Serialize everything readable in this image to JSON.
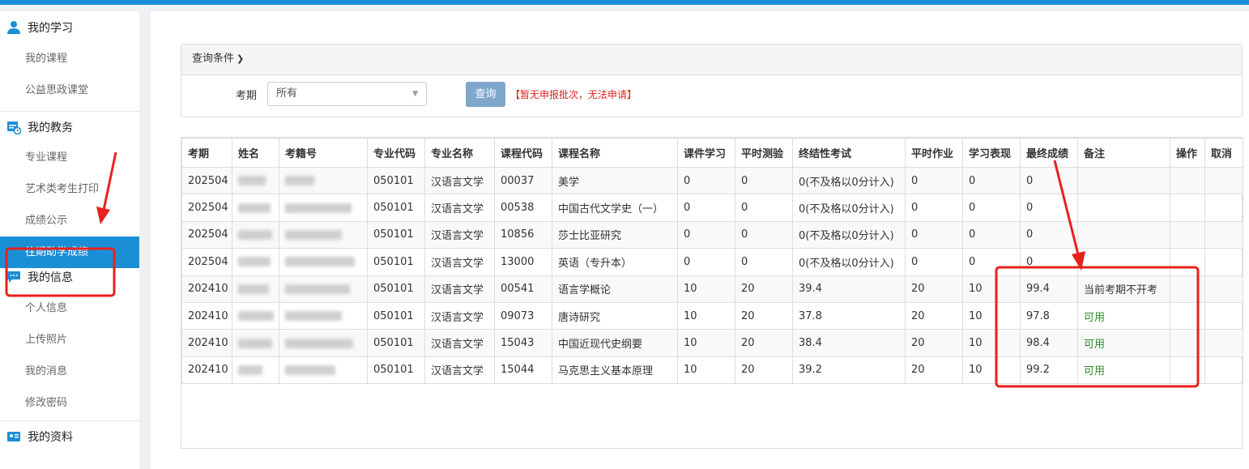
{
  "sidebar": {
    "groups": [
      {
        "title": "我的学习",
        "icon": "user-icon",
        "items": [
          "我的课程",
          "公益思政课堂"
        ]
      },
      {
        "title": "我的教务",
        "icon": "calendar-icon",
        "items": [
          "专业课程",
          "艺术类考生打印",
          "成绩公示",
          "往期助学成绩"
        ]
      },
      {
        "title": "我的信息",
        "icon": "chat-icon",
        "items": [
          "个人信息",
          "上传照片",
          "我的消息",
          "修改密码"
        ]
      },
      {
        "title": "我的资料",
        "icon": "id-card-icon",
        "items": []
      }
    ],
    "active_item": "往期助学成绩"
  },
  "query": {
    "header": "查询条件",
    "term_label": "考期",
    "term_value": "所有",
    "search_button": "查询",
    "notice": "【暂无申报批次，无法申请】"
  },
  "table": {
    "columns": [
      "考期",
      "姓名",
      "考籍号",
      "专业代码",
      "专业名称",
      "课程代码",
      "课程名称",
      "课件学习",
      "平时测验",
      "终结性考试",
      "平时作业",
      "学习表现",
      "最终成绩",
      "备注",
      "操作",
      "取消"
    ],
    "rows": [
      [
        "202504",
        "",
        "",
        "050101",
        "汉语言文学",
        "00037",
        "美学",
        "0",
        "0",
        "0(不及格以0分计入)",
        "0",
        "0",
        "0",
        "",
        "",
        ""
      ],
      [
        "202504",
        "",
        "",
        "050101",
        "汉语言文学",
        "00538",
        "中国古代文学史（一）",
        "0",
        "0",
        "0(不及格以0分计入)",
        "0",
        "0",
        "0",
        "",
        "",
        ""
      ],
      [
        "202504",
        "",
        "",
        "050101",
        "汉语言文学",
        "10856",
        "莎士比亚研究",
        "0",
        "0",
        "0(不及格以0分计入)",
        "0",
        "0",
        "0",
        "",
        "",
        ""
      ],
      [
        "202504",
        "",
        "",
        "050101",
        "汉语言文学",
        "13000",
        "英语（专升本）",
        "0",
        "0",
        "0(不及格以0分计入)",
        "0",
        "0",
        "0",
        "",
        "",
        ""
      ],
      [
        "202410",
        "",
        "",
        "050101",
        "汉语言文学",
        "00541",
        "语言学概论",
        "10",
        "20",
        "39.4",
        "20",
        "10",
        "99.4",
        "当前考期不开考",
        "",
        ""
      ],
      [
        "202410",
        "",
        "",
        "050101",
        "汉语言文学",
        "09073",
        "唐诗研究",
        "10",
        "20",
        "37.8",
        "20",
        "10",
        "97.8",
        "可用",
        "",
        ""
      ],
      [
        "202410",
        "",
        "",
        "050101",
        "汉语言文学",
        "15043",
        "中国近现代史纲要",
        "10",
        "20",
        "38.4",
        "20",
        "10",
        "98.4",
        "可用",
        "",
        ""
      ],
      [
        "202410",
        "",
        "",
        "050101",
        "汉语言文学",
        "15044",
        "马克思主义基本原理",
        "10",
        "20",
        "39.2",
        "20",
        "10",
        "99.2",
        "可用",
        "",
        ""
      ]
    ]
  },
  "colors": {
    "accent": "#1b8fd6",
    "annotation": "#e8211c",
    "available": "#2e8b2e",
    "notice": "#e02020"
  }
}
